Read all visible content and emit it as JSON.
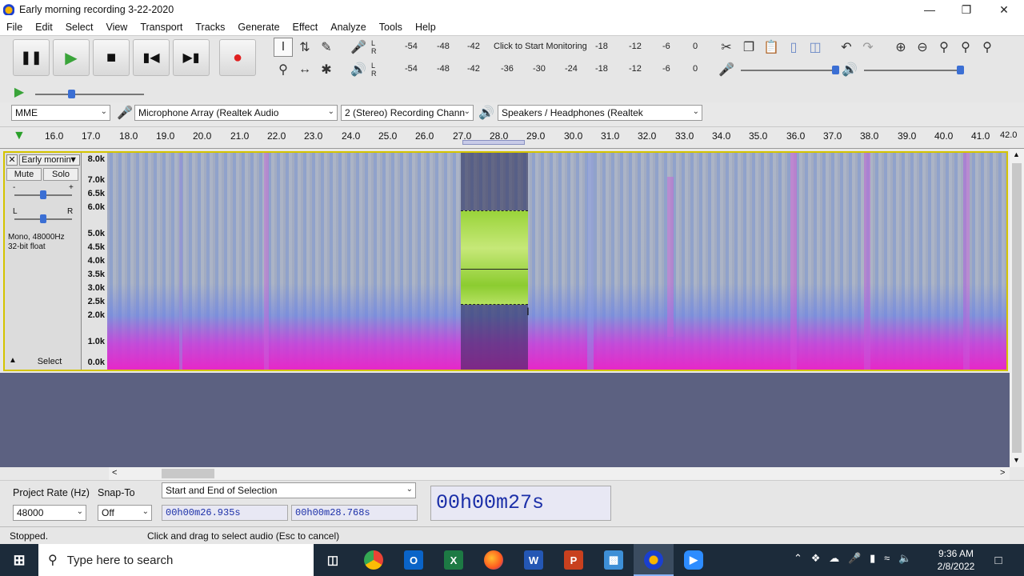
{
  "window": {
    "title": "Early morning recording 3-22-2020"
  },
  "menu": [
    "File",
    "Edit",
    "Select",
    "View",
    "Transport",
    "Tracks",
    "Generate",
    "Effect",
    "Analyze",
    "Tools",
    "Help"
  ],
  "meters": {
    "rec_ticks": [
      "-54",
      "-48",
      "-42",
      "Click to Start Monitoring",
      "-18",
      "-12",
      "-6",
      "0"
    ],
    "play_ticks": [
      "-54",
      "-48",
      "-42",
      "-36",
      "-30",
      "-24",
      "-18",
      "-12",
      "-6",
      "0"
    ],
    "channel_labels": [
      "L",
      "R"
    ]
  },
  "device": {
    "host": "MME",
    "recording_device": "Microphone Array (Realtek Audio",
    "channels": "2 (Stereo) Recording Chann",
    "playback_device": "Speakers / Headphones (Realtek"
  },
  "ruler": {
    "ticks": [
      "16.0",
      "17.0",
      "18.0",
      "19.0",
      "20.0",
      "21.0",
      "22.0",
      "23.0",
      "24.0",
      "25.0",
      "26.0",
      "27.0",
      "28.0",
      "29.0",
      "30.0",
      "31.0",
      "32.0",
      "33.0",
      "34.0",
      "35.0",
      "36.0",
      "37.0",
      "38.0",
      "39.0",
      "40.0",
      "41.0",
      "42.0"
    ]
  },
  "track": {
    "name": "Early mornin",
    "mute": "Mute",
    "solo": "Solo",
    "gain_minus": "-",
    "gain_plus": "+",
    "pan_left": "L",
    "pan_right": "R",
    "info1": "Mono, 48000Hz",
    "info2": "32-bit float",
    "select": "Select",
    "freq_labels": [
      "8.0k",
      "7.0k",
      "6.5k",
      "6.0k",
      "5.0k",
      "4.5k",
      "4.0k",
      "3.5k",
      "3.0k",
      "2.5k",
      "2.0k",
      "1.0k",
      "0.0k"
    ]
  },
  "bottom": {
    "project_rate_label": "Project Rate (Hz)",
    "project_rate_value": "48000",
    "snap_label": "Snap-To",
    "snap_value": "Off",
    "selection_mode": "Start and End of Selection",
    "sel_start": "00h00m26.935s",
    "sel_end": "00h00m28.768s",
    "position": "00h00m27s"
  },
  "status": {
    "state": "Stopped.",
    "hint": "Click and drag to select audio (Esc to cancel)"
  },
  "taskbar": {
    "search_placeholder": "Type here to search",
    "time": "9:36 AM",
    "date": "2/8/2022"
  }
}
